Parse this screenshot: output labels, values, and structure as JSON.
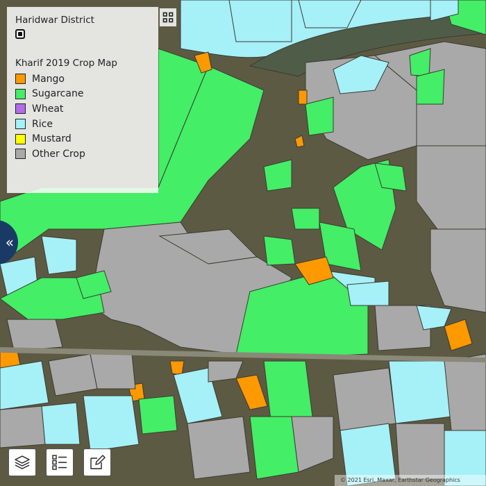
{
  "colors": {
    "mango": "#FF9900",
    "sugarcane": "#44EE66",
    "wheat": "#B36BE8",
    "rice": "#A6F0F8",
    "mustard": "#FFFF00",
    "other": "#A9A9A9",
    "background": "#5d5a44",
    "panel_collapse": "#1a3a66"
  },
  "legend": {
    "district_label": "Haridwar District",
    "crop_map_title": "Kharif 2019 Crop Map",
    "items": [
      {
        "label": "Mango",
        "color": "#FF9900"
      },
      {
        "label": "Sugarcane",
        "color": "#44EE66"
      },
      {
        "label": "Wheat",
        "color": "#B36BE8"
      },
      {
        "label": "Rice",
        "color": "#A6F0F8"
      },
      {
        "label": "Mustard",
        "color": "#FFFF00"
      },
      {
        "label": "Other Crop",
        "color": "#A9A9A9"
      }
    ]
  },
  "toolbar": {
    "collapse_glyph": "«",
    "icons": [
      "layers-icon",
      "list-icon",
      "edit-icon"
    ]
  },
  "attribution": "© 2021 Esri, Maxar, Earthstar Geographics"
}
